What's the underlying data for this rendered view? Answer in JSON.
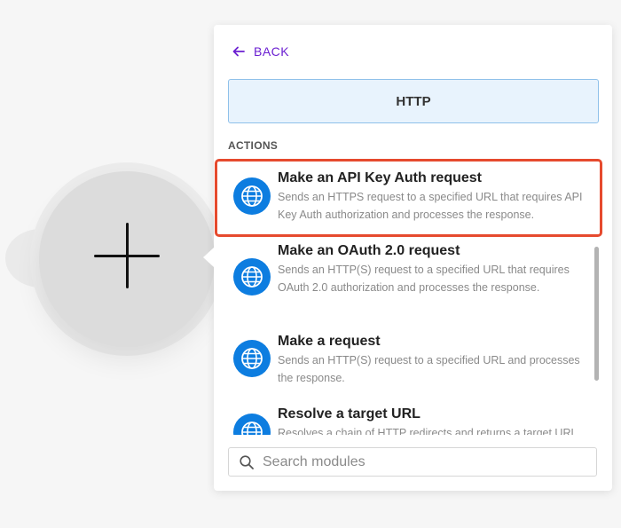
{
  "panel": {
    "back_label": "BACK",
    "app_name": "HTTP",
    "section_label": "ACTIONS"
  },
  "modules": [
    {
      "title": "Make an API Key Auth request",
      "description": "Sends an HTTPS request to a specified URL that requires API Key Auth authorization and processes the response.",
      "icon": "globe-icon"
    },
    {
      "title": "Make an OAuth 2.0 request",
      "description": "Sends an HTTP(S) request to a specified URL that requires OAuth 2.0 authorization and processes the response.",
      "icon": "globe-icon"
    },
    {
      "title": "Make a request",
      "description": "Sends an HTTP(S) request to a specified URL and processes the response.",
      "icon": "globe-icon"
    },
    {
      "title": "Resolve a target URL",
      "description": "Resolves a chain of HTTP redirects and returns a target URL.",
      "icon": "globe-icon"
    }
  ],
  "search": {
    "placeholder": "Search modules",
    "value": ""
  },
  "colors": {
    "accent": "#6b1fd1",
    "app_icon_bg": "#0d7de0",
    "highlight": "#e64a2e",
    "header_bg": "#e8f3fd"
  }
}
